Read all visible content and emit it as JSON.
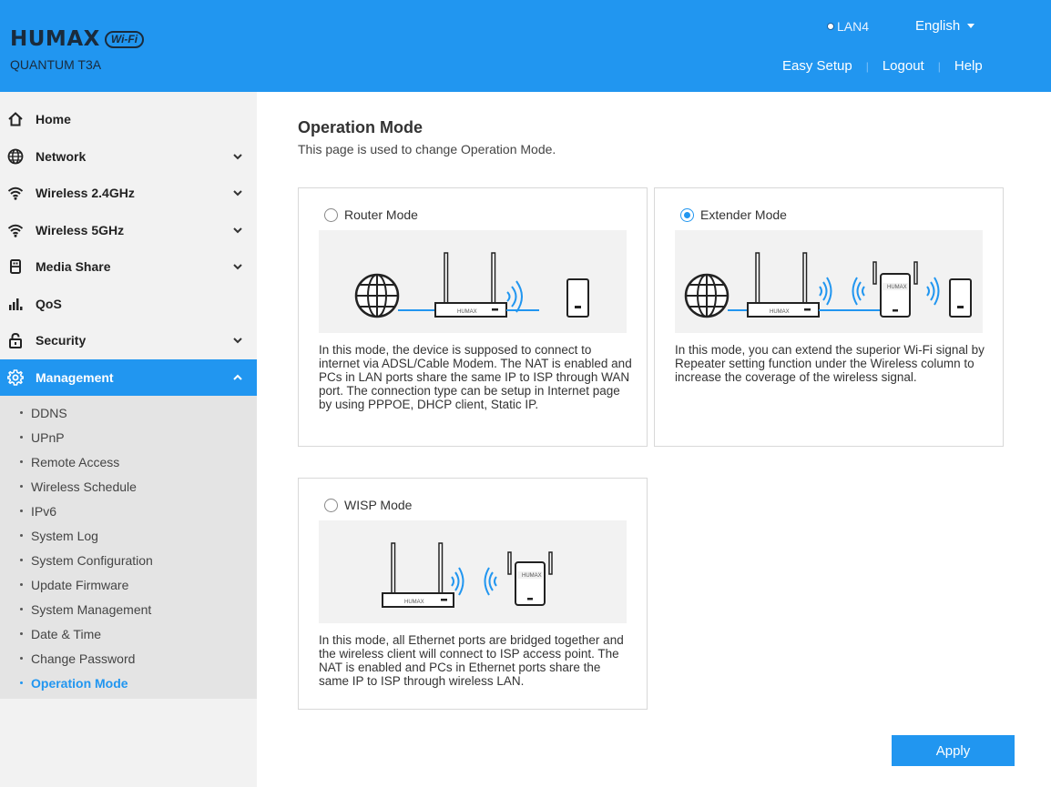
{
  "header": {
    "brand": "HUMAX",
    "brand_badge": "Wi-Fi",
    "model": "QUANTUM T3A",
    "lan_status": "LAN4",
    "language": "English",
    "links": [
      "Easy Setup",
      "Logout",
      "Help"
    ],
    "bg_color": "#2196f0"
  },
  "sidebar": {
    "items": [
      {
        "label": "Home",
        "icon": "home-icon",
        "expandable": false
      },
      {
        "label": "Network",
        "icon": "globe-icon",
        "expandable": true
      },
      {
        "label": "Wireless 2.4GHz",
        "icon": "wifi-icon",
        "expandable": true
      },
      {
        "label": "Wireless 5GHz",
        "icon": "wifi-icon",
        "expandable": true
      },
      {
        "label": "Media Share",
        "icon": "usb-icon",
        "expandable": true
      },
      {
        "label": "QoS",
        "icon": "bar-chart-icon",
        "expandable": false
      },
      {
        "label": "Security",
        "icon": "lock-icon",
        "expandable": true
      },
      {
        "label": "Management",
        "icon": "gear-icon",
        "expandable": true,
        "active": true
      }
    ],
    "submenu": [
      "DDNS",
      "UPnP",
      "Remote Access",
      "Wireless Schedule",
      "IPv6",
      "System Log",
      "System Configuration",
      "Update Firmware",
      "System Management",
      "Date & Time",
      "Change Password",
      "Operation Mode"
    ],
    "current_sub": "Operation Mode"
  },
  "main": {
    "title": "Operation Mode",
    "description": "This page is used to change Operation Mode.",
    "modes": [
      {
        "label": "Router Mode",
        "selected": false,
        "device_brand": "HUMAX",
        "desc": "In this mode, the device is supposed to connect to internet via ADSL/Cable Modem. The NAT is enabled and PCs in LAN ports share the same IP to ISP through WAN port. The connection type can be setup in Internet page by using PPPOE, DHCP client, Static IP."
      },
      {
        "label": "Extender Mode",
        "selected": true,
        "device_brand": "HUMAX",
        "desc": "In this mode, you can extend the superior Wi-Fi signal by Repeater setting function under the Wireless column to increase the coverage of the wireless signal."
      },
      {
        "label": "WISP Mode",
        "selected": false,
        "device_brand": "HUMAX",
        "desc": "In this mode, all Ethernet ports are bridged together and the wireless client will connect to ISP access point. The NAT is enabled and PCs in Ethernet ports share the same IP to ISP through wireless LAN."
      }
    ],
    "apply_label": "Apply"
  }
}
